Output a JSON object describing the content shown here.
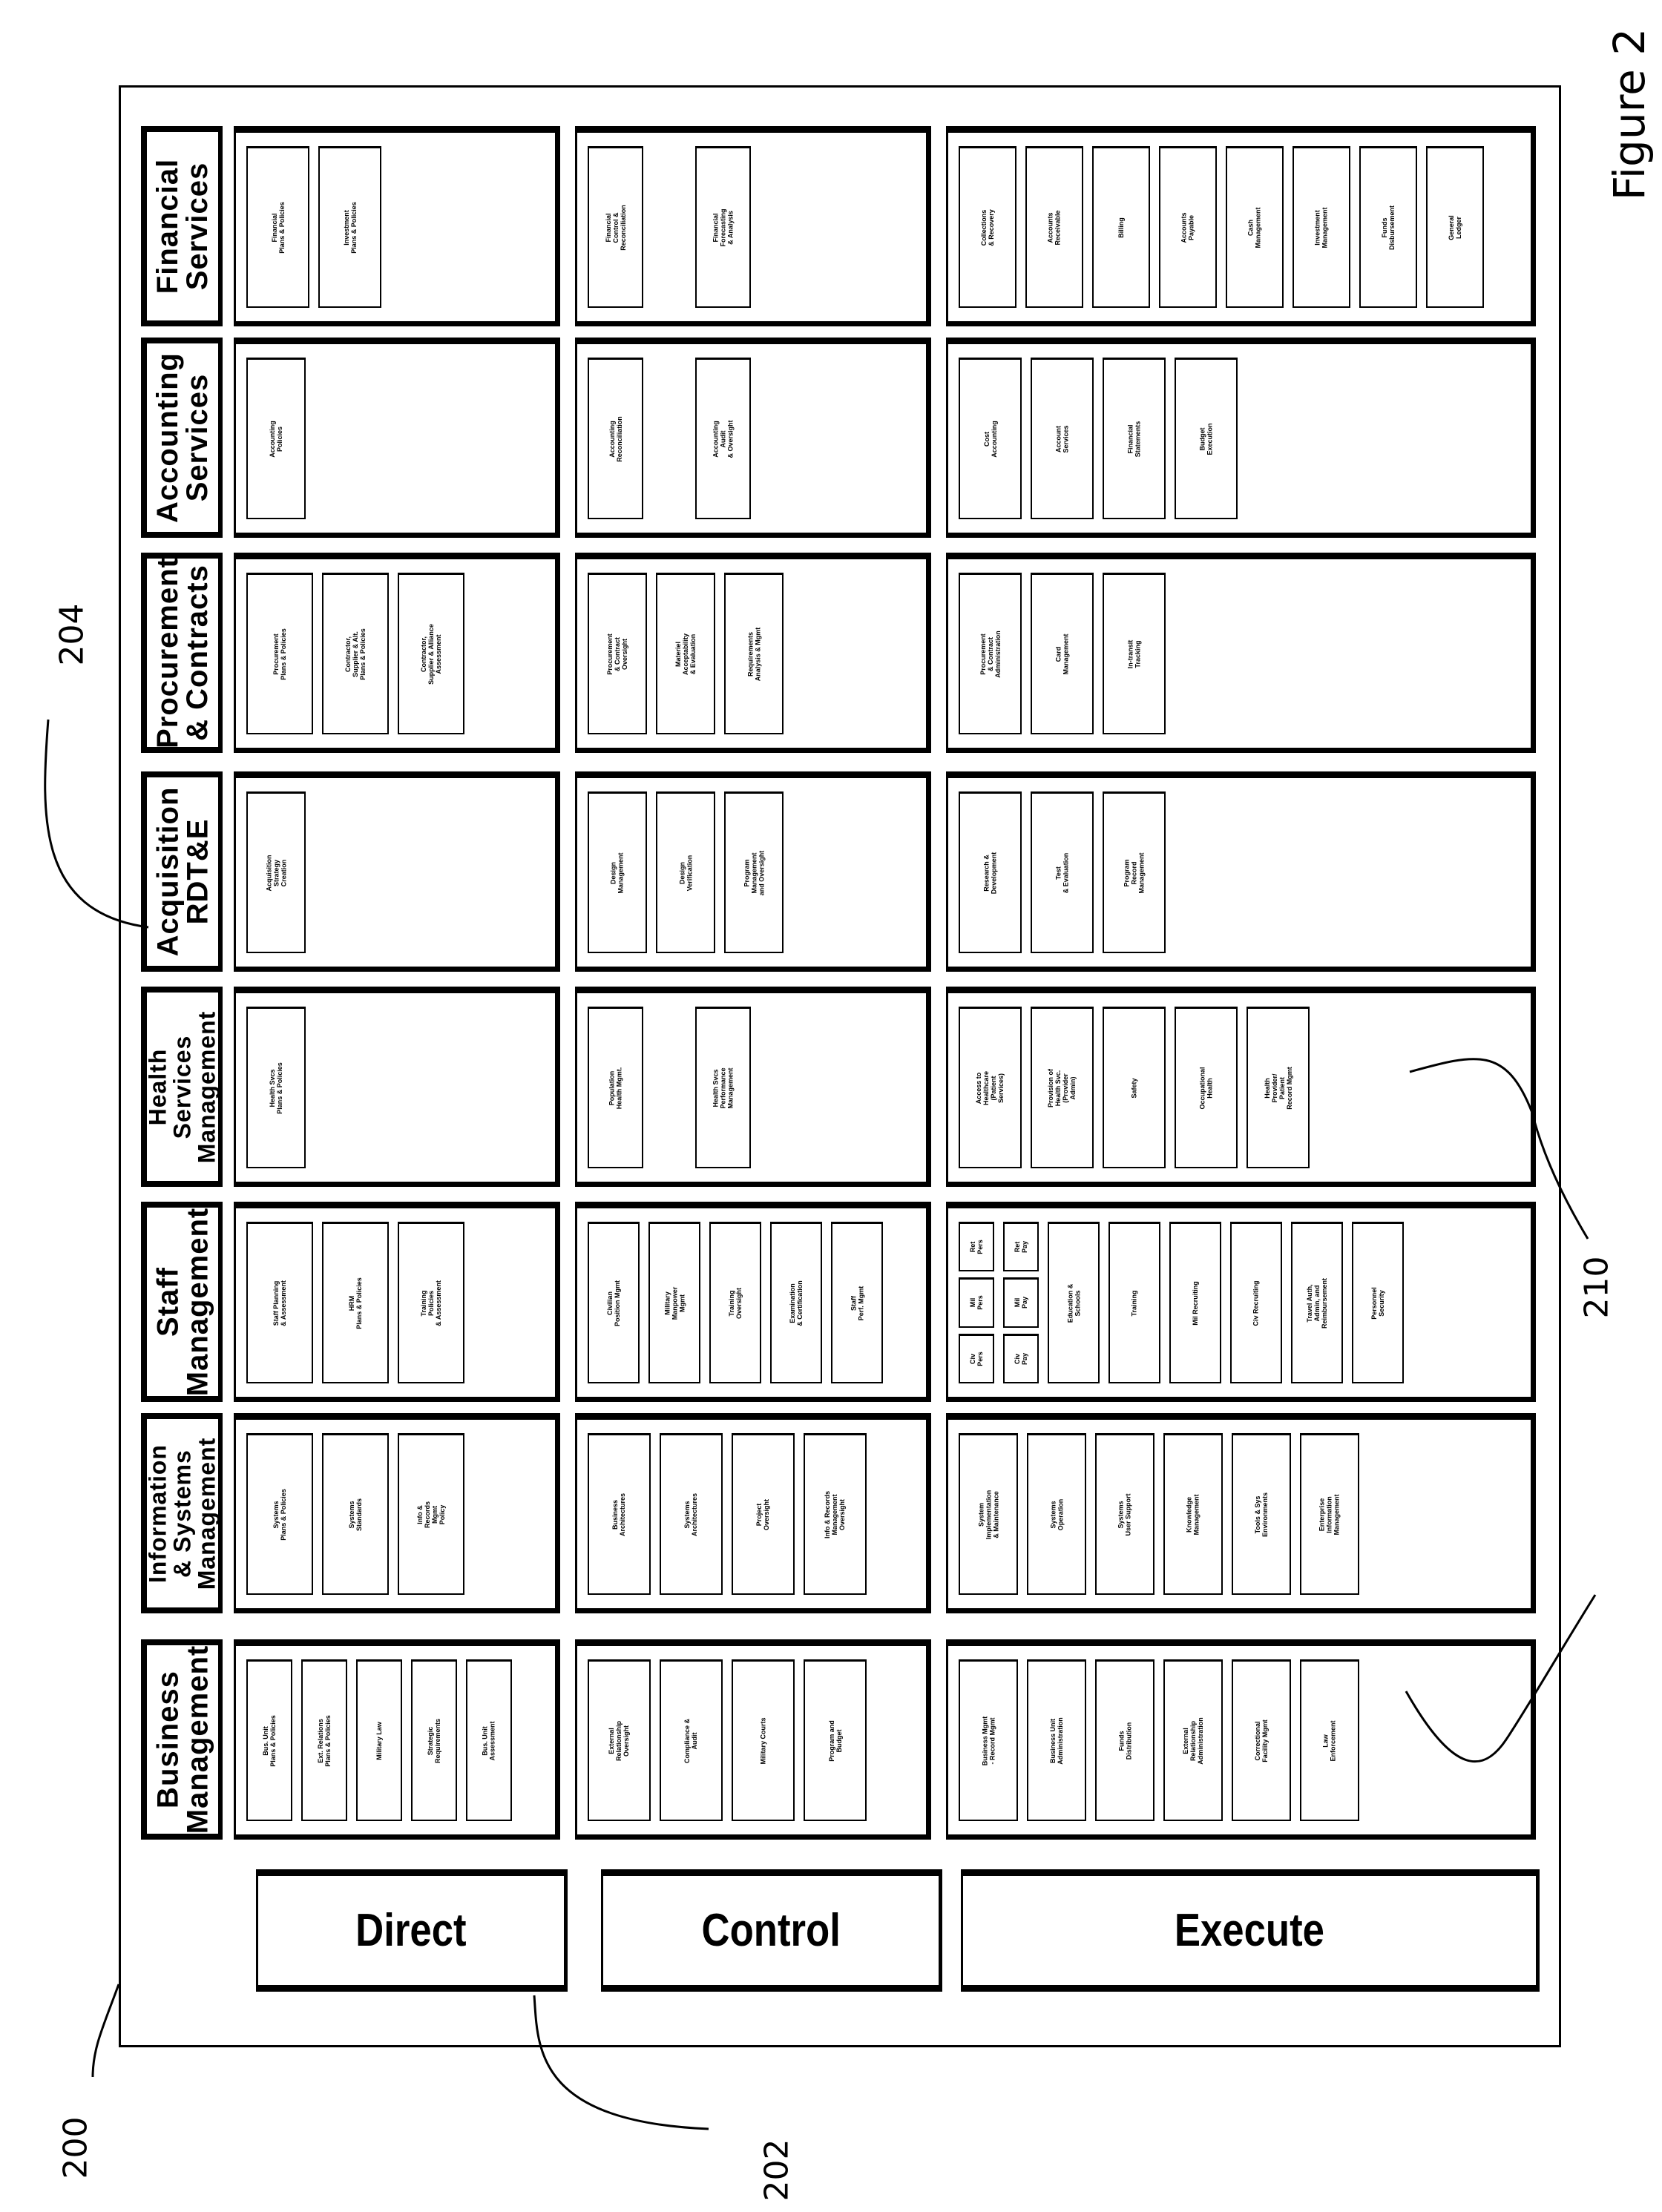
{
  "figure_label": "Figure 2",
  "reference_numerals": {
    "frame": "200",
    "tier_labels": "202",
    "functional_area_headers": "204",
    "execute_functions": "210"
  },
  "tiers": [
    {
      "id": "direct",
      "label": "Direct"
    },
    {
      "id": "control",
      "label": "Control"
    },
    {
      "id": "execute",
      "label": "Execute"
    }
  ],
  "functional_areas": [
    {
      "name": "Financial\nServices",
      "direct": [
        "Financial\nPlans & Policies",
        "Investment\nPlans & Policies"
      ],
      "control": [
        "Financial\nControl &\nReconciliation",
        "Financial\nForecasting\n& Analysis"
      ],
      "execute": [
        "Collections\n& Recovery",
        "Accounts\nReceivable",
        "Billing",
        "Accounts\nPayable",
        "Cash\nManagement",
        "Investment\nManagement",
        "Funds\nDisbursement",
        "General\nLedger"
      ]
    },
    {
      "name": "Accounting\nServices",
      "direct": [
        "Accounting\nPolicies"
      ],
      "control": [
        "Accounting\nReconciliation",
        "Accounting\nAudit\n& Oversight"
      ],
      "execute": [
        "Cost\nAccounting",
        "Account\nServices",
        "Financial\nStatements",
        "Budget\nExecution"
      ]
    },
    {
      "name": "Procurement\n& Contracts",
      "direct": [
        "Procurement\nPlans & Policies",
        "Contractor,\nSupplier & Alt.\nPlans & Policies",
        "Contractor,\nSupplier & Alliance\nAssessment"
      ],
      "control": [
        "Procurement\n& Contract\nOversight",
        "Materiel\nAcceptability\n& Evaluation",
        "Requirements\nAnalysis & Mgmt"
      ],
      "execute": [
        "Procurement\n& Contract\nAdministration",
        "Card\nManagement",
        "In-transit\nTracking"
      ]
    },
    {
      "name": "Acquisition\nRDT&E",
      "direct": [
        "Acquisition\nStrategy\nCreation"
      ],
      "control": [
        "Design\nManagement",
        "Design\nVerification",
        "Program\nManagement\nand Oversight"
      ],
      "execute": [
        "Research &\nDevelopment",
        "Test\n& Evaluation",
        "Program\nRecord\nManagement"
      ]
    },
    {
      "name": "Health\nServices\nManagement",
      "direct": [
        "Health Svcs\nPlans & Policies"
      ],
      "control": [
        "Population\nHealth Mgmt.",
        "Health Svcs\nPerformance\nManagement"
      ],
      "execute": [
        "Access to\nHealthcare\n(Patient\nServices)",
        "Provision of\nHealth Svc.\n(Provider\nAdmin)",
        "Safety",
        "Occupational\nHealth",
        "Health\nProvider/\nPatient\nRecord Mgmt"
      ]
    },
    {
      "name": "Staff\nManagement",
      "direct": [
        "Staff Planning\n& Assessment",
        "HRM\nPlans & Policies",
        "Training\nPolicies\n& Assessment"
      ],
      "control": [
        "Civilian\nPosition Mgmt",
        "Military\nManpower\nMgmt",
        "Training\nOversight",
        "Examination\n& Certification",
        "Staff\nPerf. Mgmt"
      ],
      "execute_stacks": [
        [
          "Ret\nPers",
          "Mil\nPers",
          "Civ\nPers"
        ],
        [
          "Ret\nPay",
          "Mil\nPay",
          "Civ\nPay"
        ]
      ],
      "execute": [
        "Education &\nSchools",
        "Training",
        "Mil Recruiting",
        "Civ Recruiting",
        "Travel Auth,\nAdmin, and\nReimbursement",
        "Personnel\nSecurity"
      ]
    },
    {
      "name": "Information\n& Systems\nManagement",
      "direct": [
        "Systems\nPlans & Policies",
        "Systems\nStandards",
        "Info &\nRecords\nMgmt\nPolicy"
      ],
      "control": [
        "Business\nArchitectures",
        "Systems\nArchitectures",
        "Project\nOversight",
        "Info & Records\nManagement\nOversight"
      ],
      "execute": [
        "System\nImplementation\n& Maintenance",
        "Systems\nOperation",
        "Systems\nUser Support",
        "Knowledge\nManagement",
        "Tools & Sys\nEnvironments",
        "Enterprise\nInformation\nManagement"
      ]
    },
    {
      "name": "Business\nManagement",
      "direct": [
        "Bus. Unit\nPlans & Policies",
        "Ext. Relations\nPlans & Policies",
        "Military Law",
        "Strategic\nRequirements",
        "Bus. Unit\nAssessment"
      ],
      "control": [
        "External\nRelationship\nOversight",
        "Compliance &\nAudit",
        "Military Courts",
        "Program and\nBudget"
      ],
      "execute": [
        "Business Mgmt\n- Record Mgmt",
        "Business Unit\nAdministration",
        "Funds\nDistribution",
        "External\nRelationship\nAdministration",
        "Correctional\nFacility Mgmt",
        "Law\nEnforcement"
      ]
    }
  ]
}
